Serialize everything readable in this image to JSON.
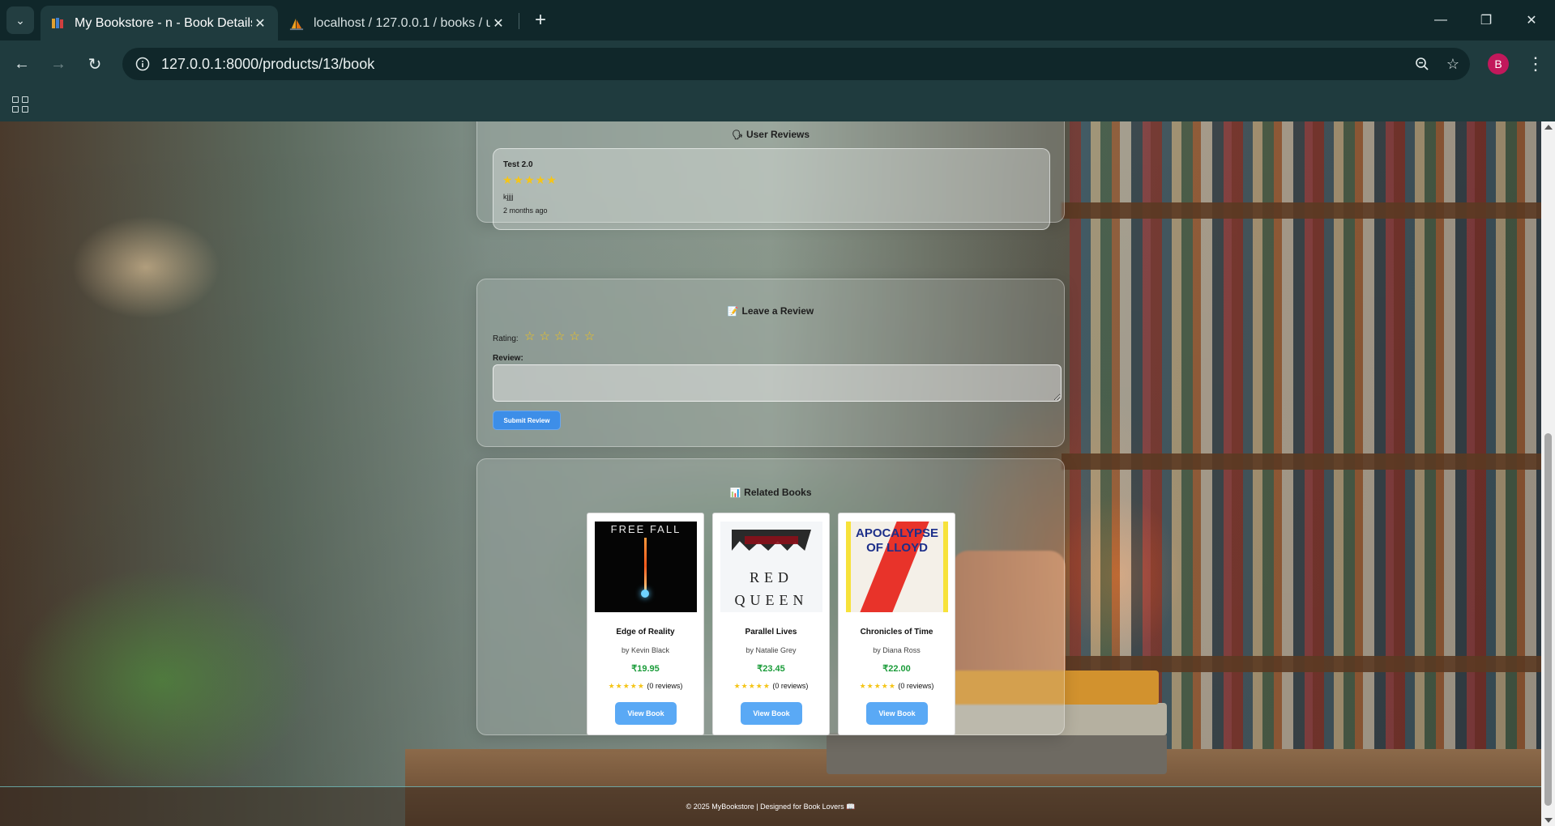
{
  "browser": {
    "tabs": [
      {
        "title": "My Bookstore - n - Book Details",
        "active": true,
        "icon": "books-icon"
      },
      {
        "title": "localhost / 127.0.0.1 / books / u",
        "active": false,
        "icon": "phpmyadmin-sail-icon"
      }
    ],
    "new_tab": "+",
    "url": "127.0.0.1:8000/products/13/book",
    "profile_initial": "B",
    "controls": {
      "minimize": "—",
      "restore": "❐",
      "close": "✕"
    }
  },
  "user_reviews": {
    "title": "User Reviews",
    "emoji": "🗣",
    "items": [
      {
        "user": "Test 2.0",
        "stars": "★★★★★",
        "rating": 5,
        "text": "kjjjj",
        "time": "2 months ago"
      }
    ]
  },
  "leave_review": {
    "title": "Leave a Review",
    "emoji": "📝",
    "rating_label": "Rating:",
    "rating_stars": "☆☆☆☆☆",
    "review_label": "Review:",
    "review_value": "",
    "submit_label": "Submit Review"
  },
  "related_books": {
    "title": "Related Books",
    "emoji": "📊",
    "books": [
      {
        "title": "Edge of Reality",
        "author": "by Kevin Black",
        "price": "₹19.95",
        "stars": "★★★★★",
        "reviews": "(0 reviews)",
        "button": "View Book",
        "cover_text": "FREE FALL"
      },
      {
        "title": "Parallel Lives",
        "author": "by Natalie Grey",
        "price": "₹23.45",
        "stars": "★★★★★",
        "reviews": "(0 reviews)",
        "button": "View Book",
        "cover_text": "RED QUEEN"
      },
      {
        "title": "Chronicles of Time",
        "author": "by Diana Ross",
        "price": "₹22.00",
        "stars": "★★★★★",
        "reviews": "(0 reviews)",
        "button": "View Book",
        "cover_text": "APOCALYPSE OF LLOYD"
      }
    ]
  },
  "footer": {
    "text": "© 2025 MyBookstore | Designed for Book Lovers 📖"
  },
  "colors": {
    "accent": "#3d8ee8",
    "price": "#1b9c3a",
    "star": "#f5c518",
    "profile": "#c2185b"
  }
}
